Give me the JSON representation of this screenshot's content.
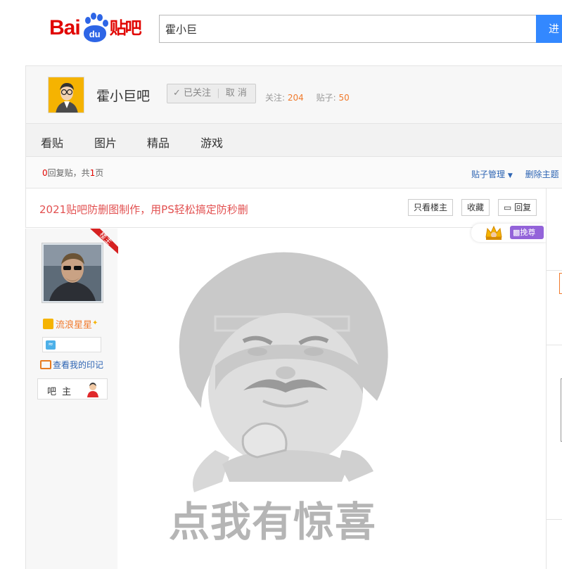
{
  "header": {
    "logo_bai": "Bai",
    "logo_du": "du",
    "logo_tieba": "贴吧",
    "search_value": "霍小巨",
    "search_button": "进"
  },
  "forum": {
    "name": "霍小巨吧",
    "follow_state": "已关注",
    "unfollow": "取 消",
    "followers_label": "关注:",
    "followers": "204",
    "posts_label": "贴子:",
    "posts": "50"
  },
  "nav": {
    "tabs": [
      "看贴",
      "图片",
      "精品",
      "游戏"
    ]
  },
  "replybar": {
    "count": "0",
    "count_suffix": "回复贴，共",
    "pages": "1",
    "pages_suffix": "页",
    "manage": "贴子管理",
    "delete": "删除主题"
  },
  "post": {
    "title": "2021贴吧防删图制作，用PS轻松搞定防秒删",
    "only_op": "只看楼主",
    "collect": "收藏",
    "reply": "回复",
    "louzhu_tag": "楼主",
    "badge_text": "挽尊",
    "meme_caption": "点我有惊喜"
  },
  "author": {
    "name": "流浪星星",
    "mark_link": "查看我的印记",
    "role": "吧 主"
  },
  "colors": {
    "brand_red": "#e10602",
    "brand_blue": "#2d65e6",
    "link_blue": "#2d64b3",
    "accent_orange": "#f17a2c"
  }
}
